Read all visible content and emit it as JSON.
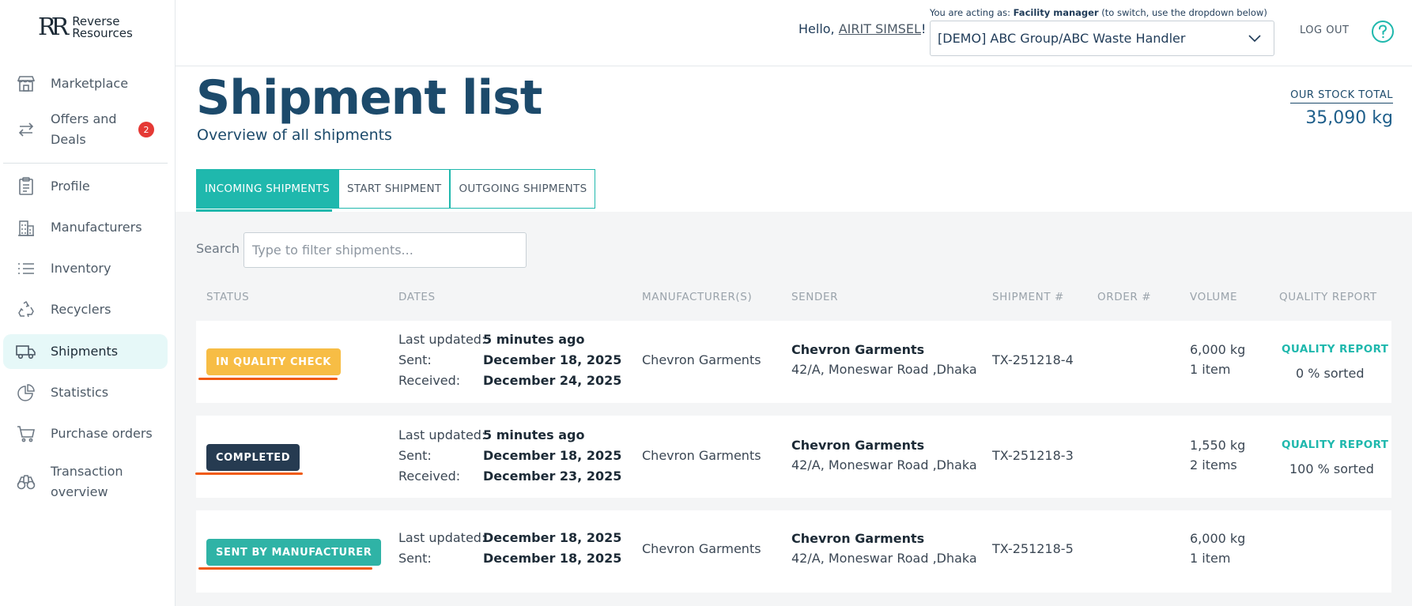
{
  "brand": {
    "logo_mark": "RR",
    "name_line1": "Reverse",
    "name_line2": "Resources"
  },
  "sidebar": {
    "items": [
      {
        "label": "Marketplace",
        "icon": "store-icon"
      },
      {
        "label": "Offers and Deals",
        "label_line1": "Offers and",
        "label_line2": "Deals",
        "icon": "swap-arrows-icon",
        "badge": "2"
      },
      {
        "label": "Profile",
        "icon": "clipboard-icon"
      },
      {
        "label": "Manufacturers",
        "icon": "building-icon"
      },
      {
        "label": "Inventory",
        "icon": "list-icon"
      },
      {
        "label": "Recyclers",
        "icon": "recycle-icon"
      },
      {
        "label": "Shipments",
        "icon": "truck-icon",
        "active": true
      },
      {
        "label": "Statistics",
        "icon": "pie-chart-icon"
      },
      {
        "label": "Purchase orders",
        "icon": "cart-icon"
      },
      {
        "label": "Transaction overview",
        "label_line1": "Transaction",
        "label_line2": "overview",
        "icon": "binoculars-icon"
      }
    ]
  },
  "topbar": {
    "hello_prefix": "Hello,",
    "user_name": "AIRIT SIMSEL",
    "hello_suffix": "!",
    "acting_prefix": "You are acting as:",
    "acting_role": "Facility manager",
    "acting_suffix": "(to switch, use the dropdown below)",
    "role_selected": "[DEMO] ABC Group/ABC Waste Handler",
    "logout_label": "LOG OUT",
    "help_icon": "question-circle-icon"
  },
  "header": {
    "title": "Shipment list",
    "subtitle": "Overview of all shipments",
    "stock_label": "OUR STOCK TOTAL",
    "stock_value": "35,090 kg"
  },
  "tabs": [
    {
      "label": "INCOMING SHIPMENTS",
      "active": true
    },
    {
      "label": "START SHIPMENT"
    },
    {
      "label": "OUTGOING SHIPMENTS"
    }
  ],
  "search": {
    "label": "Search",
    "placeholder": "Type to filter shipments..."
  },
  "table": {
    "columns": [
      "STATUS",
      "DATES",
      "MANUFACTURER(S)",
      "SENDER",
      "SHIPMENT #",
      "ORDER #",
      "VOLUME",
      "QUALITY REPORT"
    ],
    "rows": [
      {
        "status": "IN QUALITY CHECK",
        "last_updated_label": "Last updated:",
        "last_updated": "5 minutes ago",
        "sent_label": "Sent:",
        "sent": "December 18, 2025",
        "received_label": "Received:",
        "received": "December 24, 2025",
        "manufacturer": "Chevron Garments",
        "sender_name": "Chevron Garments",
        "sender_address": "42/A, Moneswar Road ,Dhaka",
        "shipment_no": "TX-251218-4",
        "order_no": "",
        "volume": "6,000 kg",
        "items": "1 item",
        "quality_link": "QUALITY REPORT",
        "sorted": "0 % sorted"
      },
      {
        "status": "COMPLETED",
        "last_updated_label": "Last updated:",
        "last_updated": "5 minutes ago",
        "sent_label": "Sent:",
        "sent": "December 18, 2025",
        "received_label": "Received:",
        "received": "December 23, 2025",
        "manufacturer": "Chevron Garments",
        "sender_name": "Chevron Garments",
        "sender_address": "42/A, Moneswar Road ,Dhaka",
        "shipment_no": "TX-251218-3",
        "order_no": "",
        "volume": "1,550 kg",
        "items": "2 items",
        "quality_link": "QUALITY REPORT",
        "sorted": "100 % sorted"
      },
      {
        "status": "SENT BY MANUFACTURER",
        "last_updated_label": "Last updated:",
        "last_updated": "December 18, 2025",
        "sent_label": "Sent:",
        "sent": "December 18, 2025",
        "manufacturer": "Chevron Garments",
        "sender_name": "Chevron Garments",
        "sender_address": "42/A, Moneswar Road ,Dhaka",
        "shipment_no": "TX-251218-5",
        "order_no": "",
        "volume": "6,000 kg",
        "items": "1 item"
      }
    ]
  },
  "colors": {
    "accent": "#1fb8ad",
    "title": "#1c4a6b",
    "status_quality_check": "#f7bd45",
    "status_completed": "#263b51",
    "status_sent": "#2fb3a6",
    "annotation_underline": "#f05a10",
    "badge_red": "#e53935"
  }
}
